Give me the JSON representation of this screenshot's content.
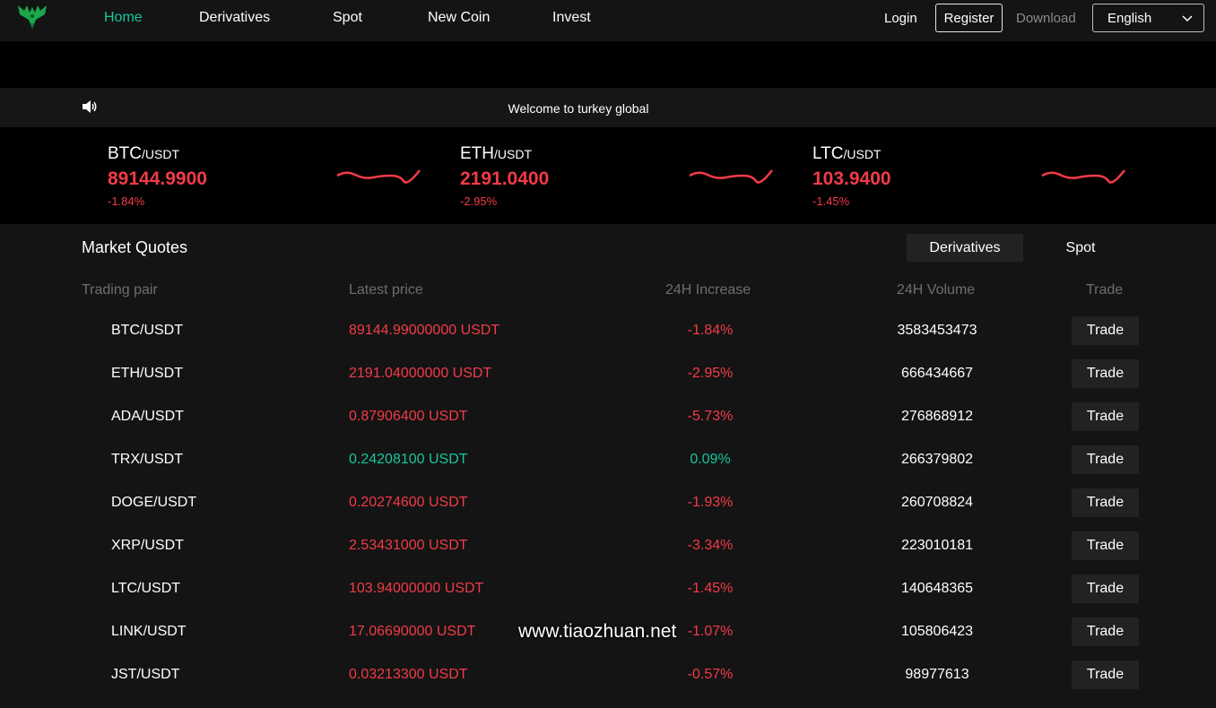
{
  "header": {
    "nav": [
      {
        "label": "Home",
        "active": true
      },
      {
        "label": "Derivatives",
        "active": false
      },
      {
        "label": "Spot",
        "active": false
      },
      {
        "label": "New Coin",
        "active": false
      },
      {
        "label": "Invest",
        "active": false
      }
    ],
    "login": "Login",
    "register": "Register",
    "download": "Download",
    "language": "English",
    "logo_icon": "phoenix-logo-icon"
  },
  "notice": {
    "text": "Welcome to turkey global",
    "icon": "speaker-icon"
  },
  "tickers": [
    {
      "base": "BTC",
      "quote": "/USDT",
      "price": "89144.9900",
      "change": "-1.84%"
    },
    {
      "base": "ETH",
      "quote": "/USDT",
      "price": "2191.0400",
      "change": "-2.95%"
    },
    {
      "base": "LTC",
      "quote": "/USDT",
      "price": "103.9400",
      "change": "-1.45%"
    }
  ],
  "market": {
    "title": "Market Quotes",
    "tabs": [
      {
        "label": "Derivatives",
        "active": true
      },
      {
        "label": "Spot",
        "active": false
      }
    ],
    "columns": [
      "Trading pair",
      "Latest price",
      "24H Increase",
      "24H Volume",
      "Trade"
    ],
    "rows": [
      {
        "pair": "BTC/USDT",
        "price": "89144.99000000 USDT",
        "increase": "-1.84%",
        "volume": "3583453473",
        "trade": "Trade",
        "up": false
      },
      {
        "pair": "ETH/USDT",
        "price": "2191.04000000 USDT",
        "increase": "-2.95%",
        "volume": "666434667",
        "trade": "Trade",
        "up": false
      },
      {
        "pair": "ADA/USDT",
        "price": "0.87906400 USDT",
        "increase": "-5.73%",
        "volume": "276868912",
        "trade": "Trade",
        "up": false
      },
      {
        "pair": "TRX/USDT",
        "price": "0.24208100 USDT",
        "increase": "0.09%",
        "volume": "266379802",
        "trade": "Trade",
        "up": true
      },
      {
        "pair": "DOGE/USDT",
        "price": "0.20274600 USDT",
        "increase": "-1.93%",
        "volume": "260708824",
        "trade": "Trade",
        "up": false
      },
      {
        "pair": "XRP/USDT",
        "price": "2.53431000 USDT",
        "increase": "-3.34%",
        "volume": "223010181",
        "trade": "Trade",
        "up": false
      },
      {
        "pair": "LTC/USDT",
        "price": "103.94000000 USDT",
        "increase": "-1.45%",
        "volume": "140648365",
        "trade": "Trade",
        "up": false
      },
      {
        "pair": "LINK/USDT",
        "price": "17.06690000 USDT",
        "increase": "-1.07%",
        "volume": "105806423",
        "trade": "Trade",
        "up": false
      },
      {
        "pair": "JST/USDT",
        "price": "0.03213300 USDT",
        "increase": "-0.57%",
        "volume": "98977613",
        "trade": "Trade",
        "up": false
      }
    ]
  },
  "watermark": "www.tiaozhuan.net",
  "colors": {
    "accent": "#17c59c",
    "down": "#f23b47",
    "up": "#17c59c",
    "background": "#141414"
  }
}
